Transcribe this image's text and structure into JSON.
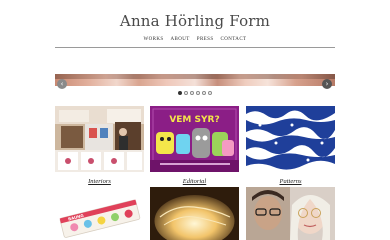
{
  "site": {
    "title": "Anna Hörling Form"
  },
  "nav": {
    "items": [
      "WORKS",
      "ABOUT",
      "PRESS",
      "CONTACT"
    ]
  },
  "slider": {
    "prev_icon": "chevron-left-icon",
    "next_icon": "chevron-right-icon",
    "prev_glyph": "‹",
    "next_glyph": "›",
    "dot_count": 6,
    "active_dot": 0
  },
  "gallery": {
    "items": [
      {
        "caption": "Interiors"
      },
      {
        "caption": "Editorial",
        "artwork_text": "VEM SYR?"
      },
      {
        "caption": "Patterns"
      },
      {
        "caption": "",
        "artwork_text": "BAUNG"
      },
      {
        "caption": ""
      },
      {
        "caption": ""
      }
    ]
  },
  "colors": {
    "accent_text": "#333333",
    "rule": "#9a9a9a",
    "editorial_bg": "#8b1e86"
  }
}
